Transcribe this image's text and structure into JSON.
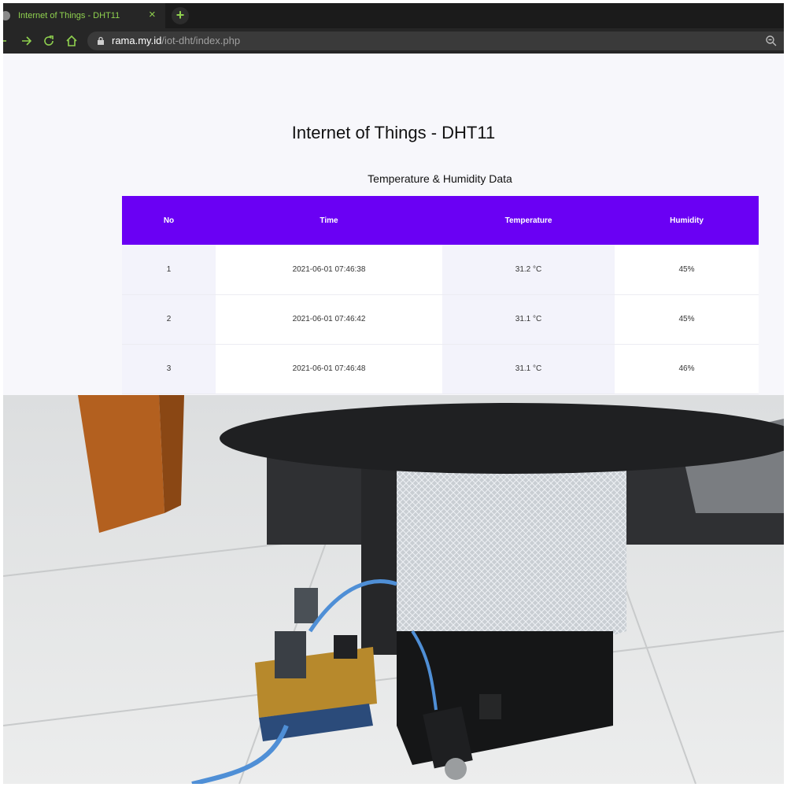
{
  "browser": {
    "tab_title": "Internet of Things - DHT11",
    "tab_close": "×",
    "new_tab": "+",
    "url_host": "rama.my.id",
    "url_path": "/iot-dht/index.php"
  },
  "page": {
    "title": "Internet of Things - DHT11",
    "caption": "Temperature & Humidity Data",
    "table": {
      "headers": [
        "No",
        "Time",
        "Temperature",
        "Humidity"
      ],
      "rows": [
        [
          "1",
          "2021-06-01 07:46:38",
          "31.2 °C",
          "45%"
        ],
        [
          "2",
          "2021-06-01 07:46:42",
          "31.1 °C",
          "45%"
        ],
        [
          "3",
          "2021-06-01 07:46:48",
          "31.1 °C",
          "46%"
        ]
      ]
    }
  },
  "colors": {
    "header_purple": "#6a00f4",
    "tab_text_green": "#8fd14f",
    "chrome_dark": "#262626"
  }
}
